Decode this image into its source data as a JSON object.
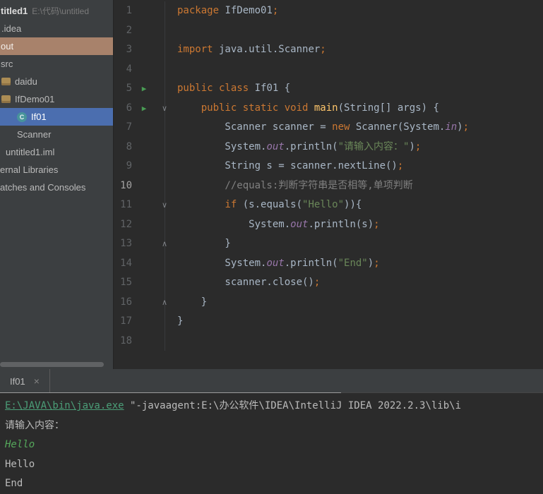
{
  "colors": {
    "selection_blue": "#4B6EAF",
    "warm_highlight": "#A8826B",
    "keyword_orange": "#CC7832",
    "string_green": "#6A8759",
    "comment_gray": "#808080",
    "field_purple": "#9876AA",
    "method_yellow": "#FFC66B",
    "link_green": "#4B9E78",
    "input_green": "#55A85B",
    "run_green": "#499C54"
  },
  "sidebar": {
    "items": [
      {
        "id": "untitled1",
        "label": "titled1",
        "path": "E:\\代码\\untitled",
        "bold": true,
        "indent": 1
      },
      {
        "id": "idea",
        "label": ".idea",
        "indent": 2
      },
      {
        "id": "out",
        "label": "out",
        "sel": "warm",
        "indent": 1
      },
      {
        "id": "src",
        "label": "src",
        "indent": 1
      },
      {
        "id": "daidu",
        "label": "daidu",
        "icon": "package",
        "indent": 2
      },
      {
        "id": "ifdemo01",
        "label": "IfDemo01",
        "icon": "package",
        "indent": 2
      },
      {
        "id": "if01",
        "label": "If01",
        "icon": "class",
        "sel": "blue",
        "indent": 24
      },
      {
        "id": "scanner",
        "label": "Scanner",
        "indent": 24
      },
      {
        "id": "untitled1-iml",
        "label": "untitled1.iml",
        "indent": 8
      },
      {
        "id": "external-libraries",
        "label": "ernal Libraries",
        "indent": 0
      },
      {
        "id": "scratches-and-consoles",
        "label": "atches and Consoles",
        "indent": 0
      }
    ]
  },
  "editor": {
    "lines": [
      {
        "n": "1",
        "seg": [
          {
            "s": "kw",
            "t": "package"
          },
          {
            "s": "pl",
            "t": " IfDemo01"
          },
          {
            "s": "semi",
            "t": ";"
          }
        ]
      },
      {
        "n": "2",
        "seg": []
      },
      {
        "n": "3",
        "seg": [
          {
            "s": "kw",
            "t": "import"
          },
          {
            "s": "pl",
            "t": " java.util.Scanner"
          },
          {
            "s": "semi",
            "t": ";"
          }
        ]
      },
      {
        "n": "4",
        "seg": []
      },
      {
        "n": "5",
        "run": true,
        "seg": [
          {
            "s": "kw",
            "t": "public class"
          },
          {
            "s": "pl",
            "t": " If01 {"
          }
        ]
      },
      {
        "n": "6",
        "run": true,
        "fold": "open",
        "seg": [
          {
            "s": "pl",
            "t": "    "
          },
          {
            "s": "kw",
            "t": "public static void "
          },
          {
            "s": "fn",
            "t": "main"
          },
          {
            "s": "pl",
            "t": "(String[] args) {"
          }
        ]
      },
      {
        "n": "7",
        "seg": [
          {
            "s": "pl",
            "t": "        Scanner scanner = "
          },
          {
            "s": "kw",
            "t": "new"
          },
          {
            "s": "pl",
            "t": " Scanner(System."
          },
          {
            "s": "fld",
            "t": "in"
          },
          {
            "s": "pl",
            "t": ")"
          },
          {
            "s": "semi",
            "t": ";"
          }
        ]
      },
      {
        "n": "8",
        "seg": [
          {
            "s": "pl",
            "t": "        System."
          },
          {
            "s": "fld",
            "t": "out"
          },
          {
            "s": "pl",
            "t": ".println("
          },
          {
            "s": "str",
            "t": "\"请输入内容：\""
          },
          {
            "s": "pl",
            "t": ")"
          },
          {
            "s": "semi",
            "t": ";"
          }
        ]
      },
      {
        "n": "9",
        "seg": [
          {
            "s": "pl",
            "t": "        String s = scanner.nextLine()"
          },
          {
            "s": "semi",
            "t": ";"
          }
        ]
      },
      {
        "n": "10",
        "active": true,
        "seg": [
          {
            "s": "cmt",
            "t": "        //equals:判断字符串是否相等,单项判断"
          }
        ]
      },
      {
        "n": "11",
        "fold": "open",
        "seg": [
          {
            "s": "pl",
            "t": "        "
          },
          {
            "s": "kw",
            "t": "if"
          },
          {
            "s": "pl",
            "t": " (s.equals("
          },
          {
            "s": "str",
            "t": "\"Hello\""
          },
          {
            "s": "pl",
            "t": ")){"
          }
        ]
      },
      {
        "n": "12",
        "seg": [
          {
            "s": "pl",
            "t": "            System."
          },
          {
            "s": "fld",
            "t": "out"
          },
          {
            "s": "pl",
            "t": ".println(s)"
          },
          {
            "s": "semi",
            "t": ";"
          }
        ]
      },
      {
        "n": "13",
        "fold": "end",
        "seg": [
          {
            "s": "pl",
            "t": "        }"
          }
        ]
      },
      {
        "n": "14",
        "seg": [
          {
            "s": "pl",
            "t": "        System."
          },
          {
            "s": "fld",
            "t": "out"
          },
          {
            "s": "pl",
            "t": ".println("
          },
          {
            "s": "str",
            "t": "\"End\""
          },
          {
            "s": "pl",
            "t": ")"
          },
          {
            "s": "semi",
            "t": ";"
          }
        ]
      },
      {
        "n": "15",
        "seg": [
          {
            "s": "pl",
            "t": "        scanner.close()"
          },
          {
            "s": "semi",
            "t": ";"
          }
        ]
      },
      {
        "n": "16",
        "fold": "end",
        "seg": [
          {
            "s": "pl",
            "t": "    }"
          }
        ]
      },
      {
        "n": "17",
        "seg": [
          {
            "s": "pl",
            "t": "}"
          }
        ]
      },
      {
        "n": "18",
        "seg": []
      }
    ]
  },
  "console": {
    "tab": {
      "label": "If01",
      "close": "×"
    },
    "lines": [
      {
        "seg": [
          {
            "s": "lnk",
            "t": "E:\\JAVA\\bin\\java.exe"
          },
          {
            "s": "pl",
            "t": " \"-javaagent:E:\\办公软件\\IDEA\\IntelliJ IDEA 2022.2.3\\lib\\i"
          }
        ]
      },
      {
        "seg": [
          {
            "s": "pl",
            "t": "请输入内容："
          }
        ]
      },
      {
        "seg": [
          {
            "s": "inp",
            "t": "Hello"
          }
        ]
      },
      {
        "seg": [
          {
            "s": "pl",
            "t": "Hello"
          }
        ]
      },
      {
        "seg": [
          {
            "s": "pl",
            "t": "End"
          }
        ]
      }
    ]
  }
}
